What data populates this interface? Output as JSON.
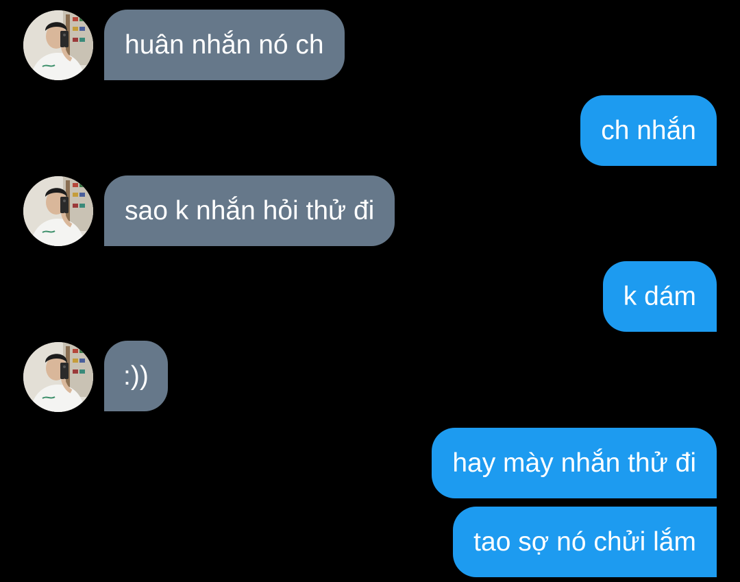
{
  "conversation": {
    "messages": [
      {
        "direction": "incoming",
        "text": "huân nhắn nó ch"
      },
      {
        "direction": "outgoing",
        "text": "ch nhắn"
      },
      {
        "direction": "incoming",
        "text": "sao k nhắn hỏi thử đi"
      },
      {
        "direction": "outgoing",
        "text": "k dám"
      },
      {
        "direction": "incoming",
        "text": ":))"
      },
      {
        "direction": "outgoing",
        "text": "hay mày nhắn thử đi"
      },
      {
        "direction": "outgoing",
        "text": "tao sợ nó chửi lắm"
      }
    ]
  },
  "colors": {
    "background": "#000000",
    "incoming_bubble": "#66788a",
    "outgoing_bubble": "#1d9bf0",
    "text": "#ffffff"
  },
  "icons": {
    "avatar": "person-photo-avatar"
  }
}
